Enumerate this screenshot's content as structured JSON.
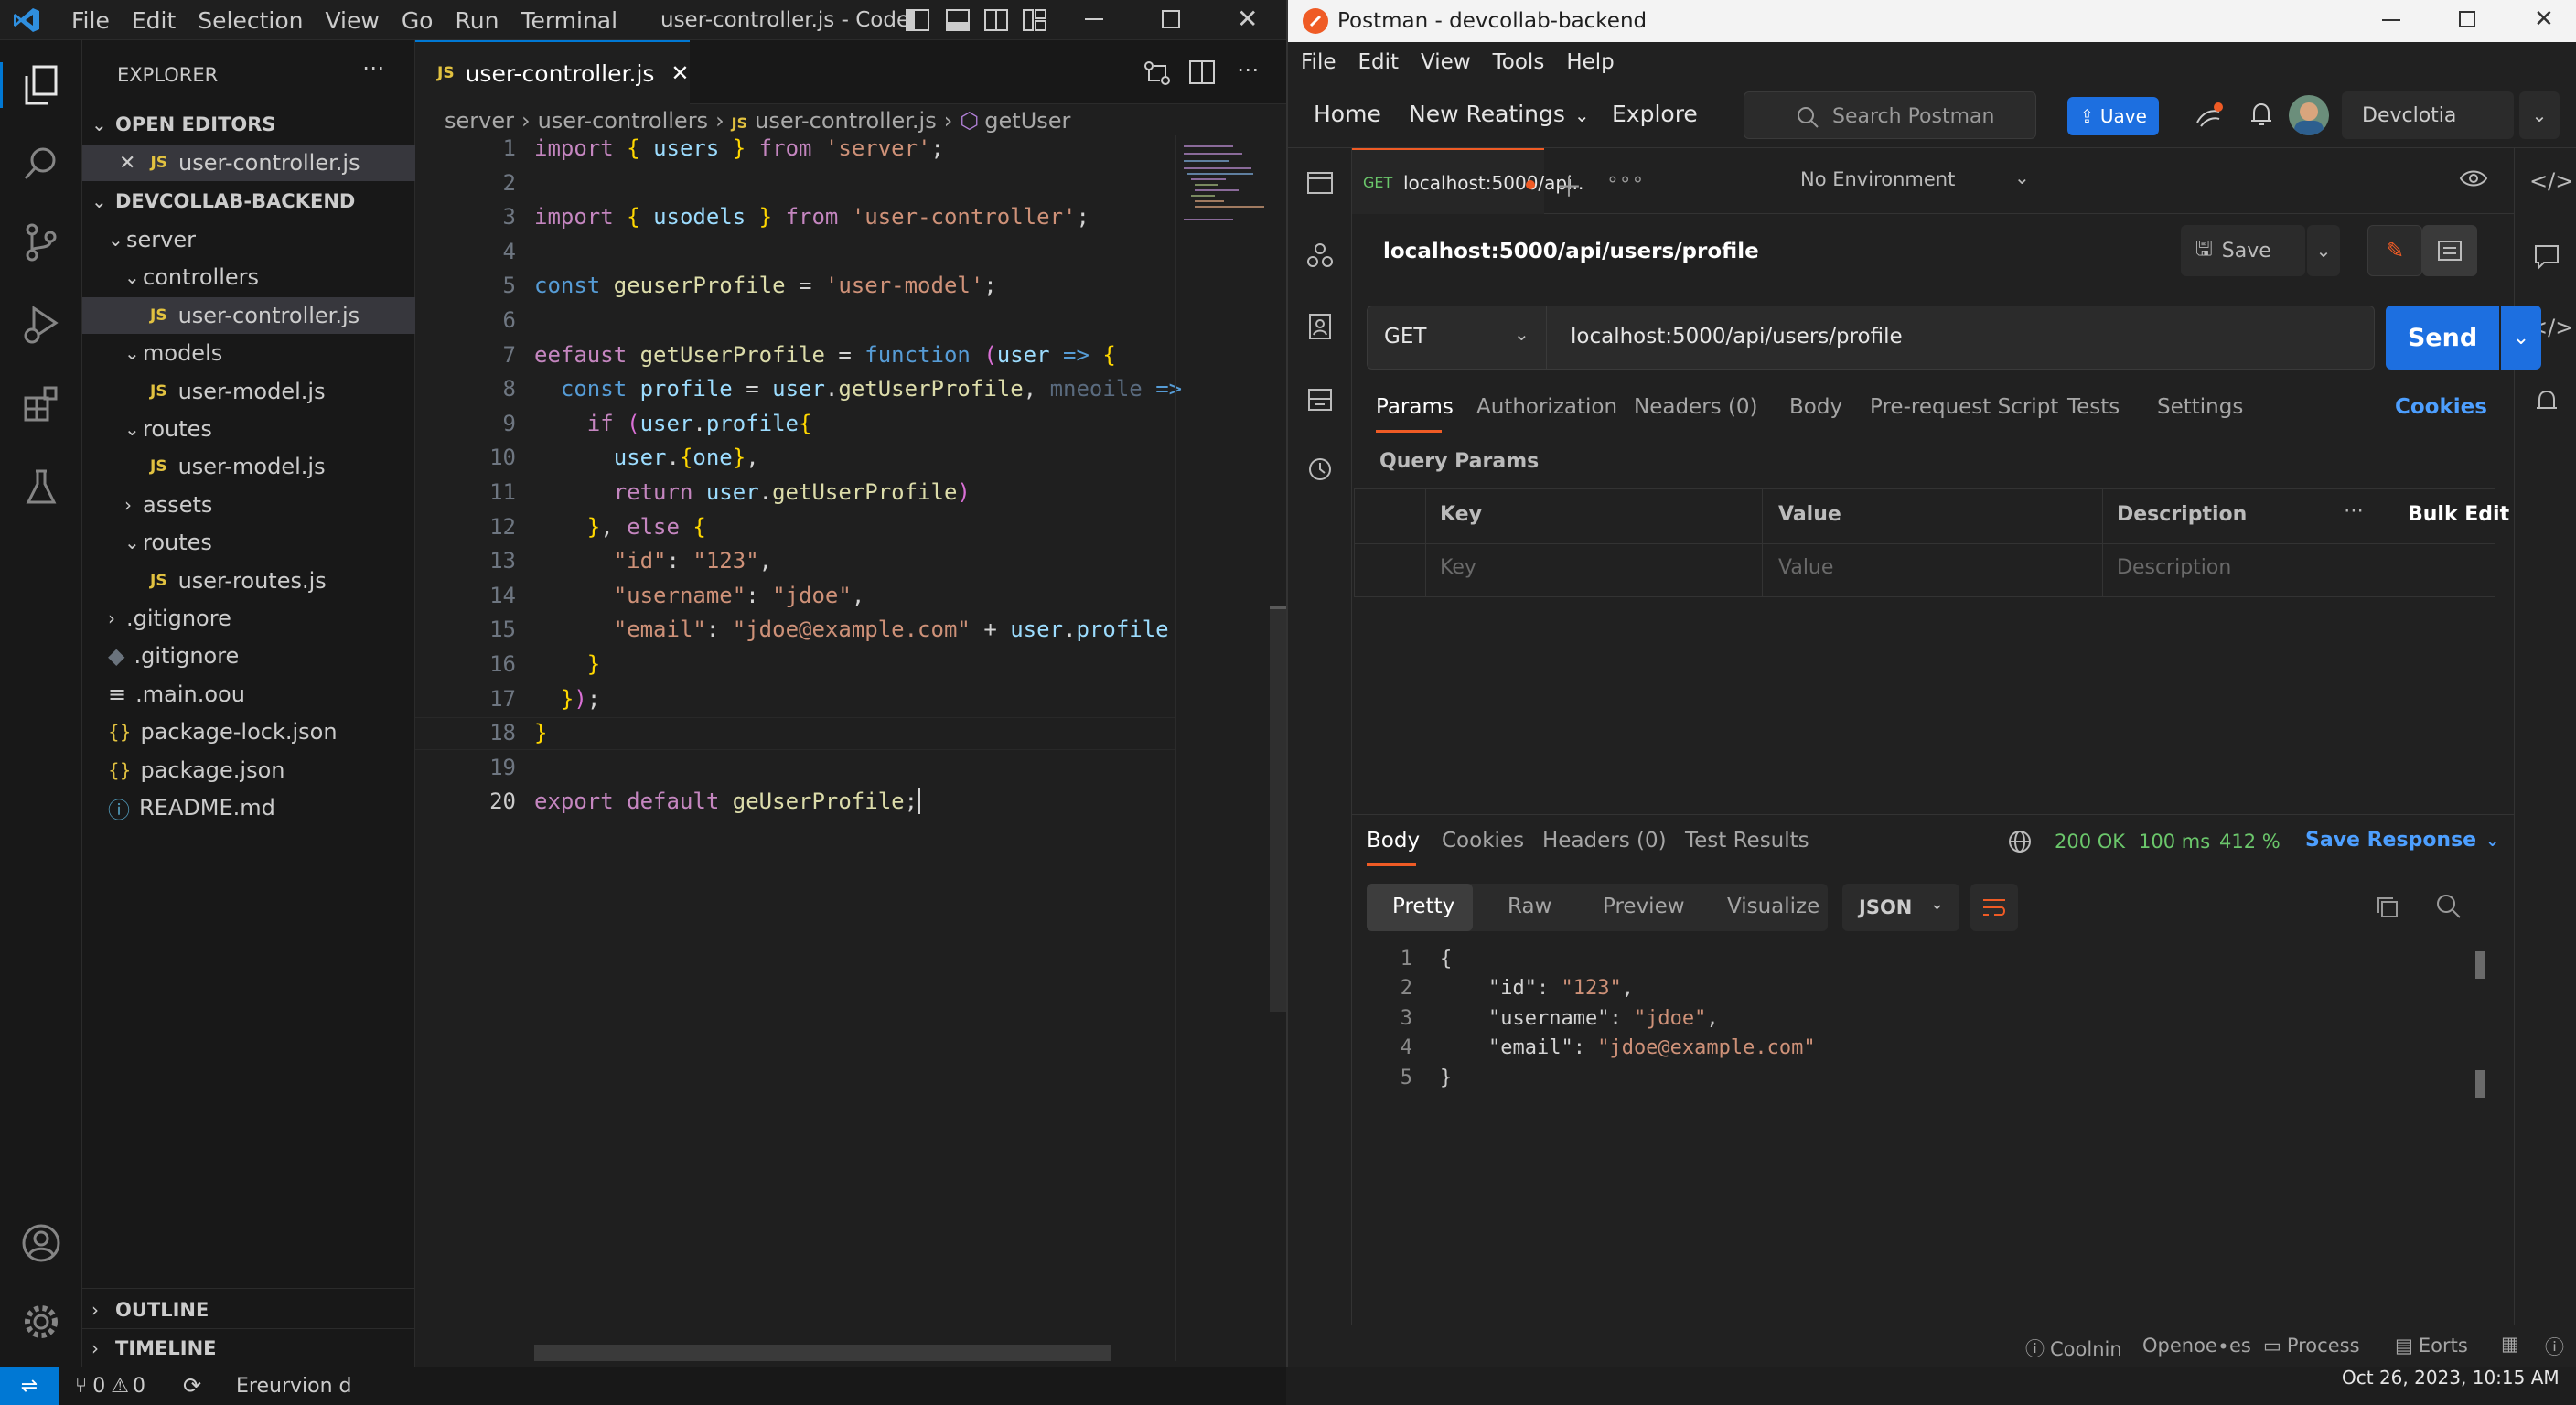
{
  "vscode": {
    "title": "user-controller.js - Code",
    "menu": [
      "File",
      "Edit",
      "Selection",
      "View",
      "Go",
      "Run",
      "Terminal"
    ],
    "explorer": {
      "header": "EXPLORER",
      "open_editors": "OPEN EDITORS",
      "open_file": "user-controller.js",
      "project": "DEVCOLLAB-BACKEND",
      "tree": [
        {
          "label": "server",
          "kind": "folder",
          "level": 1
        },
        {
          "label": "controllers",
          "kind": "folder",
          "level": 2
        },
        {
          "label": "user-controller.js",
          "kind": "js",
          "level": 3
        },
        {
          "label": "models",
          "kind": "folder",
          "level": 2
        },
        {
          "label": "user-model.js",
          "kind": "js",
          "level": 3
        },
        {
          "label": "routes",
          "kind": "folder",
          "level": 2
        },
        {
          "label": "user-model.js",
          "kind": "js",
          "level": 3
        },
        {
          "label": "assets",
          "kind": "folder-closed",
          "level": 2
        },
        {
          "label": "routes",
          "kind": "folder",
          "level": 2
        },
        {
          "label": "user-routes.js",
          "kind": "js",
          "level": 3
        },
        {
          "label": ".gitignore",
          "kind": "folder-closed",
          "level": 1
        },
        {
          "label": ".gitignore",
          "kind": "git",
          "level": 1
        },
        {
          "label": ".main.oou",
          "kind": "text",
          "level": 1
        },
        {
          "label": "package-lock.json",
          "kind": "json",
          "level": 1
        },
        {
          "label": "package.json",
          "kind": "json",
          "level": 1
        },
        {
          "label": "README.md",
          "kind": "info",
          "level": 1
        }
      ],
      "outline": "OUTLINE",
      "timeline": "TIMELINE"
    },
    "tab": "user-controller.js",
    "breadcrumb": [
      "server",
      "user-controllers",
      "user-controller.js",
      "getUser"
    ],
    "code_lines": [
      "import { users } from 'server';",
      "",
      "import { usodels } from 'user-controller';",
      "",
      "const geuserProfile = 'user-model';",
      "",
      "eefaust getUserProfile = function (user => {",
      "  const profile = user.getUserProfile, mneoile =>",
      "    if (user.profile{",
      "      user.{one},",
      "      return user.getUserProfile)",
      "    }, else {",
      "      \"id\": \"123\",",
      "      \"username\": \"jdoe\",",
      "      \"email\": \"jdoe@example.com\" + user.profile",
      "    }",
      "  });",
      "}",
      "",
      "export default geUserProfile;"
    ],
    "status": {
      "problems_errors": "0",
      "problems_warnings": "0",
      "extra": "Ereurvion d"
    }
  },
  "postman": {
    "title": "Postman - devcollab-backend",
    "menu": [
      "File",
      "Edit",
      "View",
      "Tools",
      "Help"
    ],
    "nav": {
      "home": "Home",
      "workspaces": "New Reatings",
      "explore": "Explore",
      "search_placeholder": "Search Postman",
      "upgrade": "Uave",
      "workspace": "Devclotia"
    },
    "tab_method": "GET",
    "tab_label": "localhost:5000/api..",
    "environment": "No Environment",
    "request_name": "localhost:5000/api/users/profile",
    "save": "Save",
    "method": "GET",
    "url": "localhost:5000/api/users/profile",
    "send": "Send",
    "req_tabs": [
      "Params",
      "Authorization",
      "Neaders (0)",
      "Body",
      "Pre-request Script",
      "Tests",
      "Settings"
    ],
    "cookies": "Cookies",
    "query_params": "Query Params",
    "table": {
      "key": "Key",
      "value": "Value",
      "description": "Description",
      "bulk_edit": "Bulk Edit",
      "key_ph": "Key",
      "value_ph": "Value",
      "description_ph": "Description"
    },
    "resp_tabs": [
      "Body",
      "Cookies",
      "Headers (0)",
      "Test Results"
    ],
    "status": "200 OK",
    "time": "100 ms",
    "size": "412 %",
    "save_response": "Save Response",
    "view_modes": [
      "Pretty",
      "Raw",
      "Preview",
      "Visualize"
    ],
    "format": "JSON",
    "response_lines": [
      "{",
      "    \"id\": \"123\",",
      "    \"username\": \"jdoe\",",
      "    \"email\": \"jdoe@example.com\"",
      "}"
    ],
    "footer": {
      "console": "Coolnin",
      "opener": "Openoe∙es",
      "process": "Process",
      "eorts": "Eorts",
      "datetime": "Oct 26, 2023, 10:15 AM"
    }
  }
}
